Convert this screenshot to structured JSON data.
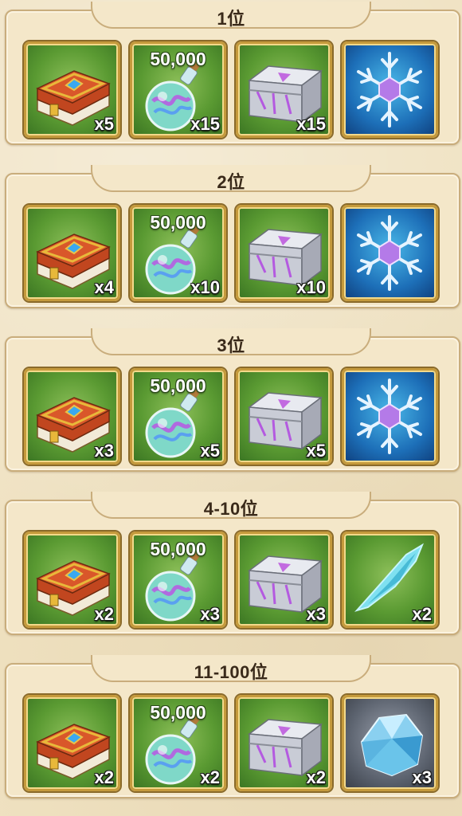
{
  "tiers": [
    {
      "rank_label": "1位",
      "rewards": [
        {
          "item": "book-icon",
          "quantity": "x5"
        },
        {
          "item": "potion-icon",
          "amount": "50,000",
          "quantity": "x15"
        },
        {
          "item": "chest-icon",
          "quantity": "x15"
        },
        {
          "item": "snowflake-icon"
        }
      ]
    },
    {
      "rank_label": "2位",
      "rewards": [
        {
          "item": "book-icon",
          "quantity": "x4"
        },
        {
          "item": "potion-icon",
          "amount": "50,000",
          "quantity": "x10"
        },
        {
          "item": "chest-icon",
          "quantity": "x10"
        },
        {
          "item": "snowflake-icon"
        }
      ]
    },
    {
      "rank_label": "3位",
      "rewards": [
        {
          "item": "book-icon",
          "quantity": "x3"
        },
        {
          "item": "potion-icon",
          "amount": "50,000",
          "quantity": "x5"
        },
        {
          "item": "chest-icon",
          "quantity": "x5"
        },
        {
          "item": "snowflake-icon"
        }
      ]
    },
    {
      "rank_label": "4-10位",
      "rewards": [
        {
          "item": "book-icon",
          "quantity": "x2"
        },
        {
          "item": "potion-icon",
          "amount": "50,000",
          "quantity": "x3"
        },
        {
          "item": "chest-icon",
          "quantity": "x3"
        },
        {
          "item": "crystal-shard-icon",
          "quantity": "x2"
        }
      ]
    },
    {
      "rank_label": "11-100位",
      "rewards": [
        {
          "item": "book-icon",
          "quantity": "x2"
        },
        {
          "item": "potion-icon",
          "amount": "50,000",
          "quantity": "x2"
        },
        {
          "item": "chest-icon",
          "quantity": "x2"
        },
        {
          "item": "ice-crystal-icon",
          "quantity": "x3"
        }
      ]
    }
  ],
  "colors": {
    "background": "#efe1c0",
    "panel": "#f4e7c9",
    "panel_border": "#c9ad7c",
    "card_frame": "#c59a3c",
    "card_green": "#5a9a32",
    "card_blue": "#1d6fb8",
    "card_grey": "#5d6470"
  }
}
